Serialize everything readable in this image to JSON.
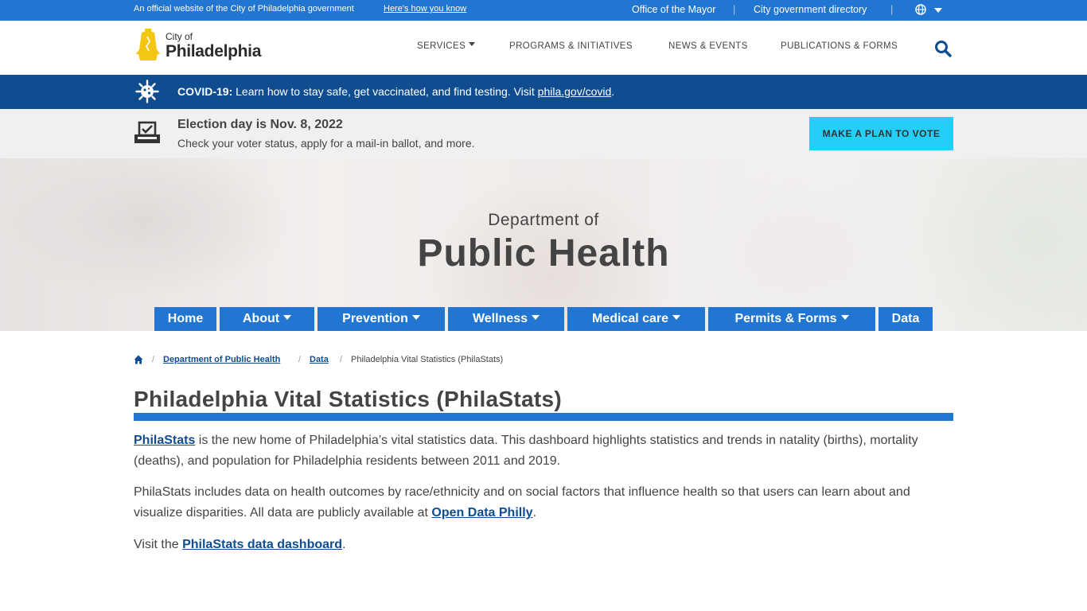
{
  "topbar": {
    "official_text": "An official website of the City of Philadelphia government",
    "how_link": "Here's how you know",
    "mayor_link": "Office of the Mayor",
    "directory_link": "City government directory",
    "separator": "|"
  },
  "header": {
    "logo_city_of": "City of",
    "logo_name": "Philadelphia",
    "nav": [
      {
        "label": "SERVICES",
        "dropdown": true
      },
      {
        "label": "PROGRAMS & INITIATIVES",
        "dropdown": false
      },
      {
        "label": "NEWS & EVENTS",
        "dropdown": false
      },
      {
        "label": "PUBLICATIONS & FORMS",
        "dropdown": false
      }
    ],
    "search_icon": "search-icon"
  },
  "covid_banner": {
    "label": "COVID-19:",
    "message": "Learn how to stay safe, get vaccinated, and find testing. Visit",
    "link": "phila.gov/covid",
    "end": "."
  },
  "election_banner": {
    "title": "Election day is Nov. 8, 2022",
    "subtitle": "Check your voter status, apply for a mail-in ballot, and more.",
    "button": "MAKE A PLAN TO VOTE"
  },
  "hero": {
    "dept_of": "Department of",
    "dept_name": "Public Health"
  },
  "subnav": [
    {
      "label": "Home",
      "dropdown": false
    },
    {
      "label": "About",
      "dropdown": true
    },
    {
      "label": "Prevention",
      "dropdown": true
    },
    {
      "label": "Wellness",
      "dropdown": true
    },
    {
      "label": "Medical care",
      "dropdown": true
    },
    {
      "label": "Permits & Forms",
      "dropdown": true
    },
    {
      "label": "Data",
      "dropdown": false
    }
  ],
  "breadcrumb": {
    "separator": "/",
    "items": [
      "Department of Public Health",
      "Data"
    ],
    "current": "Philadelphia Vital Statistics (PhilaStats)"
  },
  "content": {
    "title": "Philadelphia Vital Statistics (PhilaStats)",
    "p1_link": "PhilaStats",
    "p1_text": " is the new home of Philadelphia’s vital statistics data. This dashboard highlights statistics and trends in natality (births), mortality (deaths), and population for Philadelphia residents between 2011 and 2019.",
    "p2_text": "PhilaStats includes data on health outcomes by race/ethnicity and on social factors that influence health so that users can learn about and visualize disparities. All data are publicly available at ",
    "p2_link": "Open Data Philly",
    "p2_end": ".",
    "p3_text": "Visit the ",
    "p3_link": "PhilaStats data dashboard",
    "p3_end": "."
  },
  "colors": {
    "brand_blue": "#2176d2",
    "dark_blue": "#0f4d90",
    "cta_cyan": "#25cef7"
  }
}
